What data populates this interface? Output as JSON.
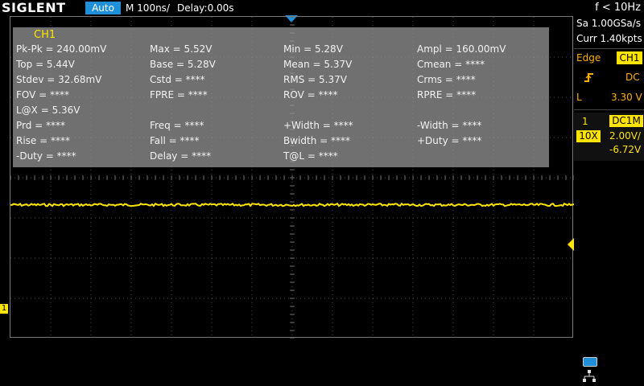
{
  "topbar": {
    "brand": "SIGLENT",
    "trigger_mode": "Auto",
    "timebase": "M 100ns/",
    "delay": "Delay:0.00s",
    "frequency": "f < 10Hz"
  },
  "measurements": {
    "channel": "CH1",
    "rows": [
      [
        "Pk-Pk = 240.00mV",
        "Max = 5.52V",
        "Min = 5.28V",
        "Ampl = 160.00mV"
      ],
      [
        "Top = 5.44V",
        "Base = 5.28V",
        "Mean = 5.37V",
        "Cmean = ****"
      ],
      [
        "Stdev = 32.68mV",
        "Cstd = ****",
        "RMS = 5.37V",
        "Crms = ****"
      ],
      [
        "FOV = ****",
        "FPRE = ****",
        "ROV = ****",
        "RPRE = ****"
      ],
      [
        "L@X = 5.36V",
        "",
        "",
        ""
      ],
      [
        "Prd = ****",
        "Freq = ****",
        "+Width = ****",
        "-Width = ****"
      ],
      [
        "Rise = ****",
        "Fall = ****",
        "Bwidth = ****",
        "+Duty = ****"
      ],
      [
        "-Duty = ****",
        "Delay = ****",
        "T@L = ****",
        ""
      ]
    ]
  },
  "side": {
    "sample_rate": "Sa 1.00GSa/s",
    "memory": "Curr 1.40kpts",
    "trigger_type": "Edge",
    "trigger_source": "CH1",
    "slope_icon": "rising-edge-icon",
    "coupling": "DC",
    "level_label": "L",
    "level_value": "3.30 V",
    "ch_number": "1",
    "ch_coupling": "DC1M",
    "probe": "10X",
    "volts_div": "2.00V/",
    "offset": "-6.72V"
  },
  "markers": {
    "channel_marker": "1"
  },
  "colors": {
    "ch1": "#ffe400",
    "accent": "#1e8fd8",
    "trigger_text": "#ffb000"
  },
  "waveform": {
    "channel": "CH1",
    "level_v": 5.37,
    "noise_pkpk_mv": 240
  }
}
